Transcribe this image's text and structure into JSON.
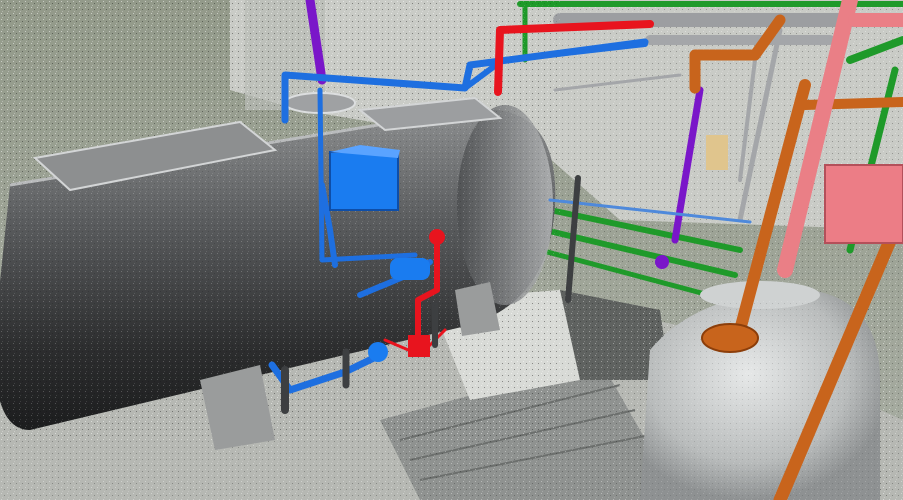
{
  "scene": {
    "subject": "point-cloud-scan-with-modeled-piping",
    "colors": {
      "sky": "#8f9687",
      "wall": "#cfd1cc",
      "floor": "#b9bbb6",
      "tank_dark": "#2e2f30",
      "tank_mid": "#6d6f70",
      "tank_light": "#c9cbcb",
      "pipe_blue": "#1e6fe0",
      "pipe_red": "#e8141e",
      "pipe_purple": "#7a16c9",
      "pipe_green": "#1f9a2a",
      "pipe_orange": "#c8641c",
      "pipe_pink": "#ea7f86",
      "pipe_gray": "#9a9c9f",
      "device_blue": "#1a7cf0",
      "device_pink": "#ec7d86"
    }
  }
}
